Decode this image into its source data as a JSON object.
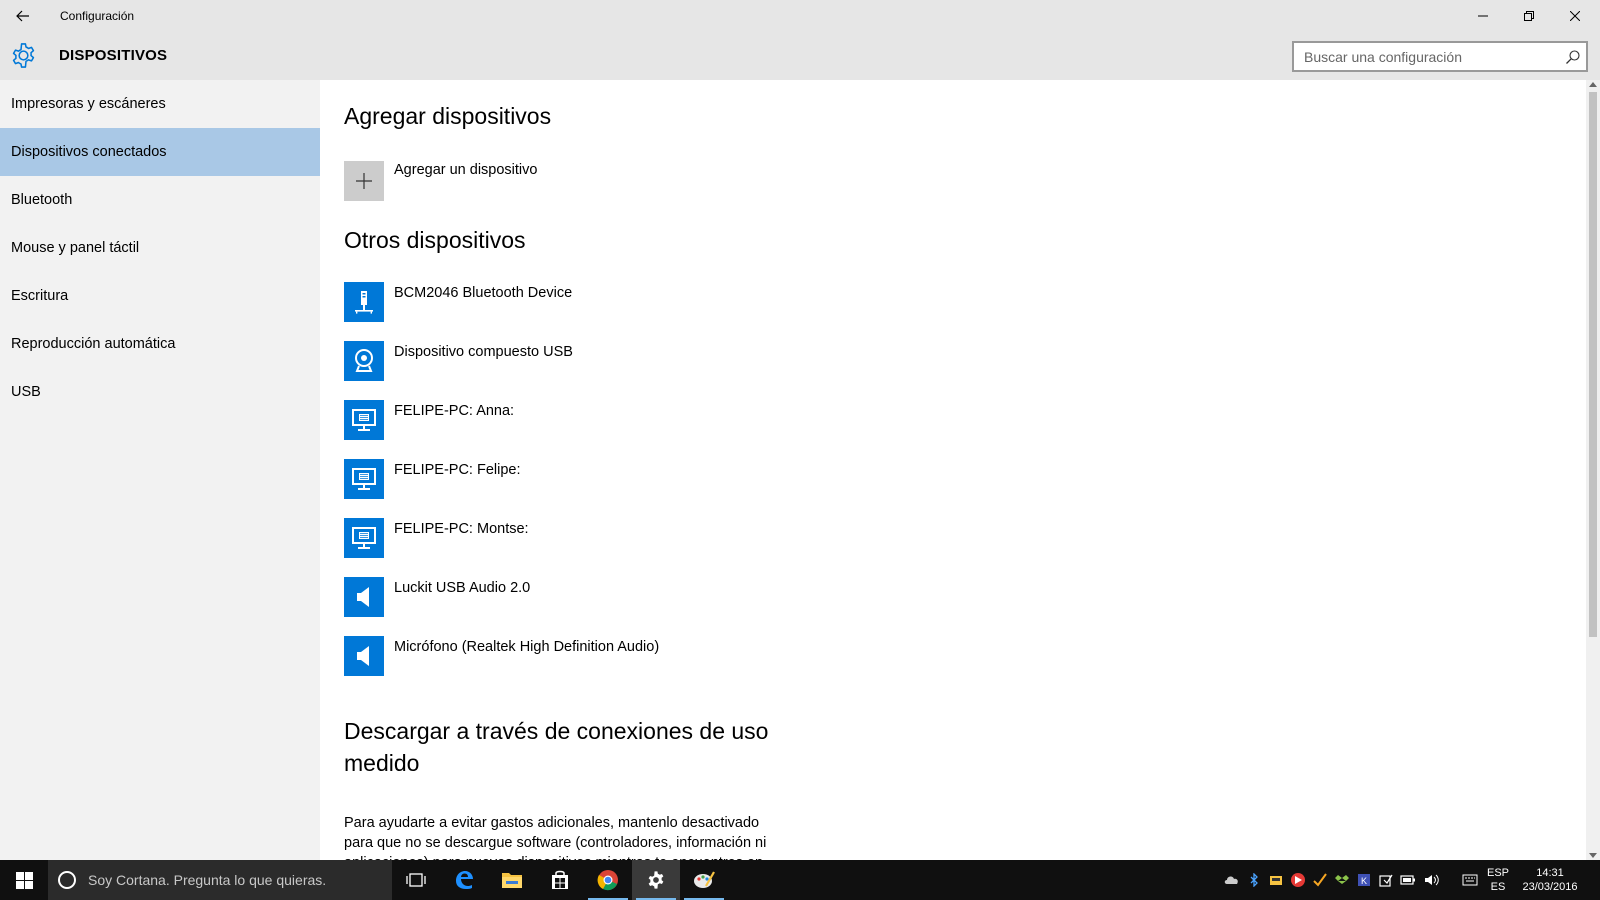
{
  "window": {
    "title": "Configuración"
  },
  "header": {
    "title": "DISPOSITIVOS",
    "search_placeholder": "Buscar una configuración"
  },
  "sidebar": {
    "items": [
      {
        "label": "Impresoras y escáneres",
        "active": false
      },
      {
        "label": "Dispositivos conectados",
        "active": true
      },
      {
        "label": "Bluetooth",
        "active": false
      },
      {
        "label": "Mouse y panel táctil",
        "active": false
      },
      {
        "label": "Escritura",
        "active": false
      },
      {
        "label": "Reproducción automática",
        "active": false
      },
      {
        "label": "USB",
        "active": false
      }
    ]
  },
  "content": {
    "add_section": {
      "heading": "Agregar dispositivos",
      "add_label": "Agregar un dispositivo"
    },
    "other_section": {
      "heading": "Otros dispositivos",
      "devices": [
        {
          "name": "BCM2046 Bluetooth Device",
          "icon": "usb-device-icon"
        },
        {
          "name": "Dispositivo compuesto USB",
          "icon": "webcam-icon"
        },
        {
          "name": "FELIPE-PC: Anna:",
          "icon": "monitor-icon"
        },
        {
          "name": "FELIPE-PC: Felipe:",
          "icon": "monitor-icon"
        },
        {
          "name": "FELIPE-PC: Montse:",
          "icon": "monitor-icon"
        },
        {
          "name": "Luckit USB Audio 2.0",
          "icon": "speaker-icon"
        },
        {
          "name": "Micrófono (Realtek High Definition Audio)",
          "icon": "speaker-icon"
        }
      ]
    },
    "metered_section": {
      "heading_line1": "Descargar a través de conexiones de uso",
      "heading_line2": "medido",
      "description": "Para ayudarte a evitar gastos adicionales, mantenlo desactivado para que no se descargue software (controladores, información ni aplicaciones) para nuevos dispositivos mientras te encuentres en"
    }
  },
  "taskbar": {
    "cortana_text": "Soy Cortana. Pregunta lo que quieras.",
    "lang_line1": "ESP",
    "lang_line2": "ES",
    "time": "14:31",
    "date": "23/03/2016"
  },
  "colors": {
    "accent": "#0078d7",
    "sidebar_active": "#a9c8e6",
    "titlebar": "#e6e6e6",
    "sidebar_bg": "#f2f2f2",
    "taskbar": "#101010"
  }
}
